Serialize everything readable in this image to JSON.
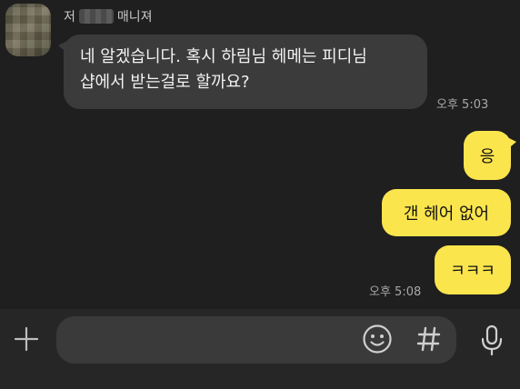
{
  "sender": {
    "name_suffix": "매니져",
    "name_prefix_visible": "저"
  },
  "messages_in": {
    "line1": "네 알겠습니다. 혹시 하림님 헤메는 피디님",
    "line2": "샵에서 받는걸로 할까요?",
    "time": "오후 5:03"
  },
  "messages_out": {
    "m1": "응",
    "m2": "갠 헤어 없어",
    "m3": "ㅋㅋㅋ",
    "time": "오후 5:08"
  },
  "input": {
    "value": "",
    "placeholder": ""
  },
  "icons": {
    "plus": "plus-icon",
    "emoji": "emoji-icon",
    "hash": "hash-icon",
    "mic": "mic-icon"
  },
  "colors": {
    "background": "#1f1f1f",
    "incoming_bubble": "#3b3b3b",
    "outgoing_bubble": "#fbe54d",
    "input_bar": "#262626"
  }
}
